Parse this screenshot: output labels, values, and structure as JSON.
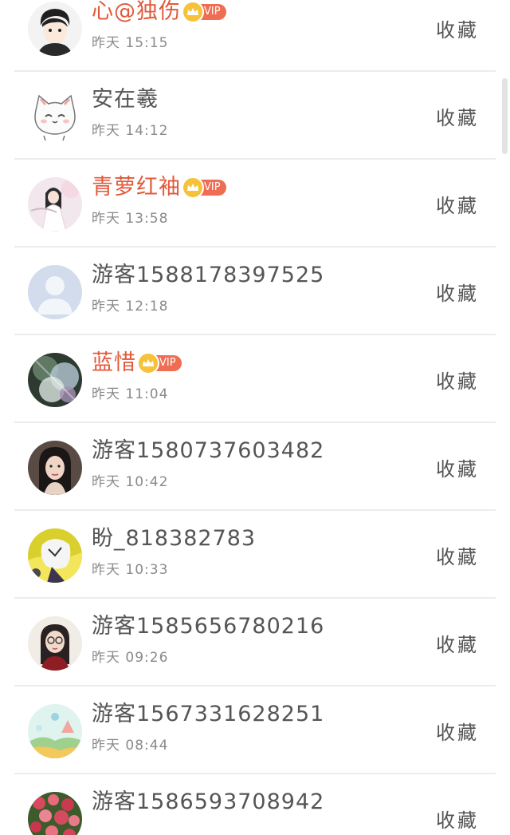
{
  "favorite_label": "收藏",
  "vip_label": "VIP",
  "colors": {
    "vip_name": "#e2583a",
    "badge": "#ef6d52",
    "crown": "#f6c23a"
  },
  "items": [
    {
      "name": "心@独伤",
      "time": "昨天 15:15",
      "vip": true,
      "avatar": "cartoon-boy-avatar"
    },
    {
      "name": "安在羲",
      "time": "昨天 14:12",
      "vip": false,
      "avatar": "cartoon-cat-avatar"
    },
    {
      "name": "青萝红袖",
      "time": "昨天 13:58",
      "vip": true,
      "avatar": "girl-white-dress-avatar"
    },
    {
      "name": "游客1588178397525",
      "time": "昨天 12:18",
      "vip": false,
      "avatar": "default-user-avatar"
    },
    {
      "name": "蓝惜",
      "time": "昨天 11:04",
      "vip": true,
      "avatar": "fantasy-art-avatar"
    },
    {
      "name": "游客1580737603482",
      "time": "昨天 10:42",
      "vip": false,
      "avatar": "girl-portrait-avatar"
    },
    {
      "name": "盼_818382783",
      "time": "昨天 10:33",
      "vip": false,
      "avatar": "anime-character-avatar"
    },
    {
      "name": "游客1585656780216",
      "time": "昨天 09:26",
      "vip": false,
      "avatar": "woman-glasses-avatar"
    },
    {
      "name": "游客1567331628251",
      "time": "昨天 08:44",
      "vip": false,
      "avatar": "landscape-illustration-avatar"
    },
    {
      "name": "游客1586593708942",
      "time": "",
      "vip": false,
      "avatar": "flowers-avatar"
    }
  ]
}
